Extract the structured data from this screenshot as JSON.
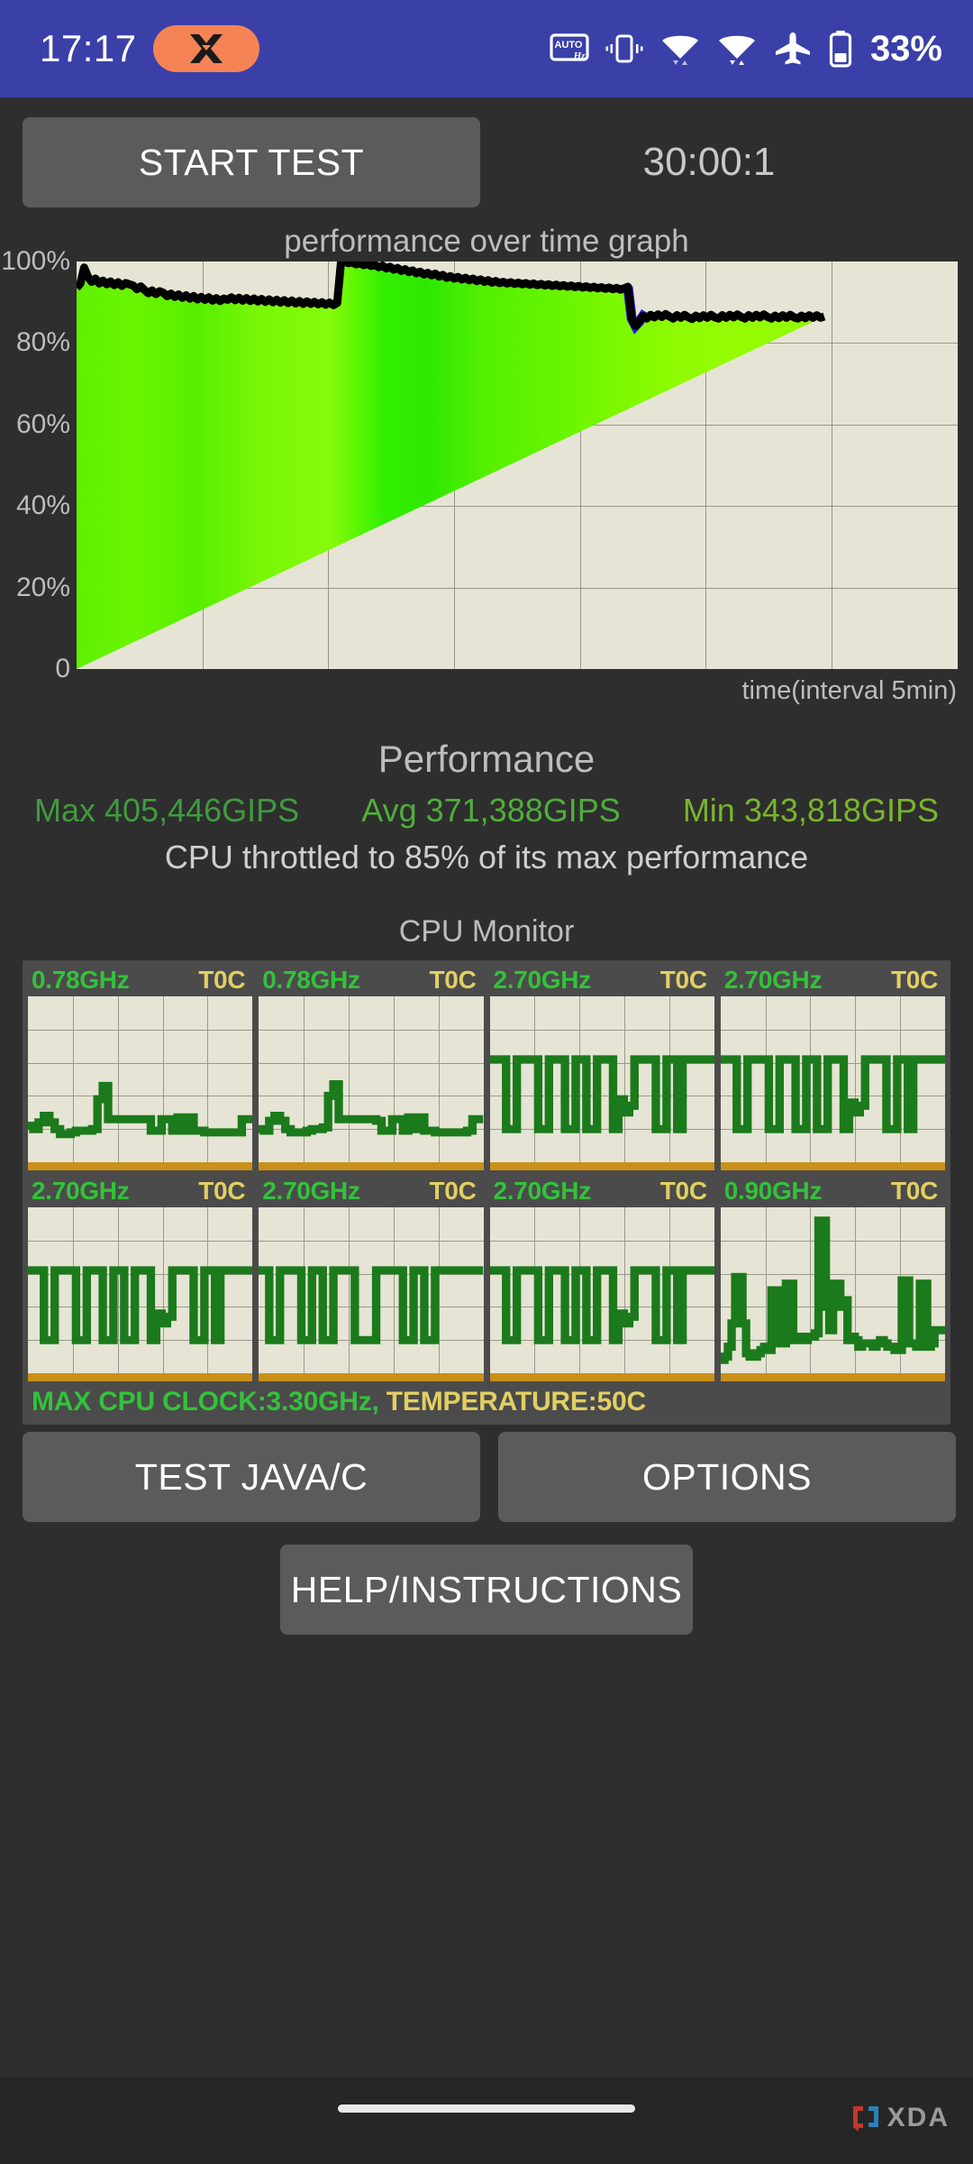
{
  "status_bar": {
    "clock": "17:17",
    "app_badge_icon": "x-logo-icon",
    "icons": [
      {
        "name": "auto-refresh-rate-icon",
        "label": "AUTO Hz"
      },
      {
        "name": "vibrate-icon",
        "label": "Vibrate"
      },
      {
        "name": "wifi-icon",
        "label": "Wi-Fi"
      },
      {
        "name": "wifi-data-icon",
        "label": "Wi-Fi data"
      },
      {
        "name": "airplane-mode-icon",
        "label": "Airplane mode"
      },
      {
        "name": "battery-icon",
        "label": "Battery"
      }
    ],
    "battery_percent": "33%",
    "bg_color": "#3a40a8",
    "accent_color": "#f58355"
  },
  "toolbar": {
    "start_test_label": "START TEST",
    "timer": "30:00:1"
  },
  "graph": {
    "title": "performance over time graph",
    "x_axis_label": "time(interval 5min)",
    "y_ticks": [
      "100%",
      "80%",
      "60%",
      "40%",
      "20%",
      "0"
    ],
    "bg_color": "#e6e4d4",
    "line_color": "#000000",
    "dip_color": "#2222dd"
  },
  "chart_data": {
    "type": "area",
    "title": "performance over time graph",
    "xlabel": "time(interval 5min)",
    "ylabel": "",
    "ylim": [
      0,
      100
    ],
    "yticks": [
      0,
      20,
      40,
      60,
      80,
      100
    ],
    "grid": true,
    "legend": "none",
    "x_interval_minutes": 5,
    "x_total_minutes": 35,
    "note": "Values are % of maximum performance; series ends at ~30 min of a 35 min axis",
    "series": [
      {
        "name": "performance %",
        "x": [
          0.0,
          0.15,
          0.3,
          0.45,
          0.6,
          0.75,
          0.9,
          1.05,
          1.2,
          1.35,
          1.5,
          1.65,
          1.8,
          1.95,
          2.1,
          2.25,
          2.4,
          2.55,
          2.7,
          2.85,
          3.0,
          3.15,
          3.3,
          3.45,
          3.6,
          3.75,
          3.9,
          4.05,
          4.2,
          4.35,
          4.5,
          4.65,
          4.8,
          4.95,
          5.1,
          5.25,
          5.4,
          5.55,
          5.7,
          5.85,
          6.0,
          6.15,
          6.3,
          6.45,
          6.6,
          6.75,
          6.9,
          7.05,
          7.2,
          7.35,
          7.5,
          7.65,
          7.8,
          7.95,
          8.1,
          8.25,
          8.4,
          8.55,
          8.7,
          8.85,
          9.0,
          9.15,
          9.3,
          9.45,
          9.6,
          9.75,
          9.9,
          10.05,
          10.2,
          10.35,
          10.5,
          10.65,
          10.8,
          10.95,
          11.1,
          11.25,
          11.4,
          11.55,
          11.7,
          11.85,
          12.0,
          12.15,
          12.3,
          12.45,
          12.6,
          12.75,
          12.9,
          13.05,
          13.2,
          13.35,
          13.5,
          13.65,
          13.8,
          13.95,
          14.1,
          14.25,
          14.4,
          14.55,
          14.7,
          14.85,
          15.0,
          15.15,
          15.3,
          15.45,
          15.6,
          15.75,
          15.9,
          16.05,
          16.2,
          16.35,
          16.5,
          16.65,
          16.8,
          16.95,
          17.1,
          17.25,
          17.4,
          17.55,
          17.7,
          17.85,
          18.0,
          18.15,
          18.3,
          18.45,
          18.6,
          18.75,
          18.9,
          19.05,
          19.2,
          19.35,
          19.5,
          19.65,
          19.8,
          19.95,
          20.1,
          20.25,
          20.4,
          20.55,
          20.7,
          20.85,
          21.0,
          21.15,
          21.3,
          21.45,
          21.6,
          21.75,
          21.9,
          22.05,
          22.2,
          22.35,
          22.5,
          22.65,
          22.8,
          22.95,
          23.1,
          23.25,
          23.4,
          23.55,
          23.7,
          23.85,
          24.0,
          24.15,
          24.3,
          24.45,
          24.6,
          24.75,
          24.9,
          25.05,
          25.2,
          25.35,
          25.5,
          25.65,
          25.8,
          25.95,
          26.1,
          26.25,
          26.4,
          26.55,
          26.7,
          26.85,
          27.0,
          27.15,
          27.3,
          27.45,
          27.6,
          27.75,
          27.9,
          28.05,
          28.2,
          28.35,
          28.5,
          28.65,
          28.8,
          28.95,
          29.1,
          29.25,
          29.4,
          29.55,
          29.7,
          29.85,
          30.0
        ],
        "y": [
          93.5,
          94.6,
          98.5,
          96.3,
          95.0,
          95.8,
          94.6,
          95.3,
          94.4,
          95.1,
          94.2,
          94.9,
          94.0,
          94.7,
          94.4,
          94.1,
          93.2,
          93.9,
          93.0,
          92.2,
          92.9,
          92.0,
          92.7,
          92.3,
          91.5,
          92.1,
          91.3,
          91.9,
          91.1,
          91.7,
          90.9,
          91.5,
          90.7,
          91.3,
          90.6,
          91.2,
          90.4,
          91.0,
          90.3,
          90.9,
          90.6,
          91.2,
          90.5,
          91.1,
          90.4,
          91.0,
          90.3,
          90.9,
          90.2,
          90.8,
          90.1,
          90.7,
          90.0,
          90.6,
          89.9,
          90.5,
          89.8,
          90.4,
          89.7,
          90.3,
          89.6,
          90.2,
          89.6,
          90.1,
          89.5,
          90.0,
          89.4,
          89.9,
          89.3,
          89.8,
          99.6,
          100.0,
          99.6,
          99.8,
          99.3,
          99.6,
          99.1,
          99.4,
          98.9,
          99.2,
          98.6,
          99.0,
          98.3,
          98.7,
          98.0,
          98.4,
          97.7,
          98.1,
          97.4,
          97.8,
          97.1,
          97.5,
          96.8,
          97.2,
          96.6,
          97.0,
          96.3,
          96.7,
          96.0,
          96.4,
          95.8,
          96.2,
          95.6,
          96.0,
          95.4,
          95.8,
          95.2,
          95.6,
          95.0,
          95.4,
          94.8,
          95.2,
          94.7,
          95.0,
          94.6,
          94.9,
          94.5,
          94.8,
          94.4,
          94.7,
          94.3,
          94.6,
          94.2,
          94.5,
          94.1,
          94.4,
          94.0,
          94.3,
          93.9,
          94.2,
          93.8,
          94.1,
          93.7,
          94.0,
          93.6,
          93.9,
          93.5,
          93.8,
          93.4,
          93.7,
          93.3,
          93.6,
          93.2,
          93.5,
          93.1,
          93.4,
          93.8,
          86.0,
          84.2,
          85.2,
          86.6,
          86.0,
          86.9,
          86.3,
          87.0,
          86.4,
          87.1,
          86.5,
          86.0,
          86.8,
          86.2,
          86.9,
          86.3,
          85.9,
          86.7,
          86.1,
          86.8,
          86.2,
          86.9,
          86.3,
          86.0,
          86.8,
          86.2,
          86.9,
          86.3,
          87.0,
          86.4,
          86.0,
          86.8,
          86.2,
          86.9,
          86.3,
          87.0,
          86.4,
          86.0,
          86.7,
          86.1,
          86.8,
          86.2,
          86.9,
          86.3,
          86.0,
          86.7,
          86.1,
          86.8,
          86.2,
          86.8,
          86.2,
          86.5
        ]
      }
    ]
  },
  "performance": {
    "title": "Performance",
    "max_label": "Max 405,446GIPS",
    "avg_label": "Avg 371,388GIPS",
    "min_label": "Min 343,818GIPS",
    "max_color": "#3f9b3f",
    "avg_color": "#4fae3a",
    "min_color": "#79b52c",
    "throttle_note": "CPU throttled to 85% of its max performance"
  },
  "cpu_monitor": {
    "title": "CPU Monitor",
    "cores": [
      {
        "freq": "0.78GHz",
        "temp": "T0C",
        "load": [
          22,
          20,
          24,
          28,
          24,
          20,
          17,
          17,
          18,
          19,
          19,
          19,
          20,
          38,
          46,
          26,
          26,
          26,
          26,
          26,
          26,
          26,
          26,
          19,
          19,
          26,
          26,
          19,
          27,
          19,
          27,
          19,
          19,
          18,
          18,
          18,
          18,
          18,
          18,
          18,
          26,
          26,
          26
        ]
      },
      {
        "freq": "0.78GHz",
        "temp": "T0C",
        "load": [
          20,
          19,
          25,
          28,
          25,
          20,
          18,
          18,
          18,
          19,
          20,
          20,
          21,
          40,
          47,
          26,
          26,
          26,
          26,
          26,
          26,
          26,
          25,
          19,
          19,
          26,
          26,
          19,
          27,
          20,
          27,
          19,
          19,
          18,
          18,
          18,
          18,
          18,
          18,
          19,
          26,
          26,
          26
        ]
      },
      {
        "freq": "2.70GHz",
        "temp": "T0C",
        "load": [
          62,
          62,
          62,
          20,
          20,
          62,
          62,
          62,
          62,
          20,
          20,
          62,
          62,
          62,
          20,
          20,
          62,
          62,
          20,
          20,
          62,
          62,
          62,
          20,
          38,
          30,
          34,
          62,
          62,
          62,
          62,
          20,
          20,
          62,
          62,
          20,
          62,
          62,
          62,
          62,
          62,
          62,
          62
        ]
      },
      {
        "freq": "2.70GHz",
        "temp": "T0C",
        "load": [
          62,
          62,
          62,
          20,
          20,
          62,
          62,
          62,
          62,
          20,
          20,
          62,
          62,
          62,
          20,
          20,
          62,
          62,
          20,
          20,
          62,
          62,
          62,
          20,
          36,
          30,
          34,
          62,
          62,
          62,
          62,
          20,
          20,
          62,
          62,
          20,
          62,
          62,
          62,
          62,
          62,
          62,
          62
        ]
      },
      {
        "freq": "2.70GHz",
        "temp": "T0C",
        "load": [
          62,
          62,
          62,
          20,
          20,
          62,
          62,
          62,
          62,
          20,
          20,
          62,
          62,
          62,
          20,
          20,
          62,
          62,
          20,
          20,
          62,
          62,
          62,
          20,
          36,
          30,
          34,
          62,
          62,
          62,
          62,
          20,
          20,
          62,
          62,
          20,
          62,
          62,
          62,
          62,
          62,
          62,
          62
        ]
      },
      {
        "freq": "2.70GHz",
        "temp": "T0C",
        "load": [
          62,
          62,
          20,
          20,
          62,
          62,
          62,
          62,
          20,
          20,
          62,
          62,
          20,
          20,
          62,
          62,
          62,
          62,
          20,
          20,
          20,
          20,
          62,
          62,
          62,
          62,
          62,
          20,
          20,
          62,
          62,
          20,
          20,
          62,
          62,
          62,
          62,
          62,
          62,
          62,
          62,
          62,
          62
        ]
      },
      {
        "freq": "2.70GHz",
        "temp": "T0C",
        "load": [
          62,
          62,
          62,
          20,
          20,
          62,
          62,
          62,
          62,
          20,
          20,
          62,
          62,
          62,
          20,
          20,
          62,
          62,
          20,
          20,
          62,
          62,
          62,
          20,
          36,
          30,
          34,
          62,
          62,
          62,
          62,
          20,
          20,
          62,
          62,
          20,
          62,
          62,
          62,
          62,
          62,
          62,
          62
        ]
      },
      {
        "freq": "0.90GHz",
        "temp": "T0C",
        "load": [
          8,
          10,
          16,
          30,
          58,
          58,
          30,
          12,
          10,
          10,
          12,
          14,
          16,
          14,
          50,
          50,
          18,
          18,
          54,
          54,
          20,
          22,
          20,
          20,
          22,
          22,
          24,
          92,
          92,
          40,
          26,
          54,
          54,
          40,
          44,
          20,
          22,
          20,
          16,
          18,
          18,
          18,
          16,
          18,
          20,
          18,
          16,
          16,
          14,
          14,
          56,
          56,
          18,
          18,
          16,
          54,
          54,
          16,
          18,
          26,
          26,
          26,
          26
        ]
      }
    ],
    "footer_clock": "MAX CPU CLOCK:3.30GHz,",
    "footer_temp": " TEMPERATURE:50C",
    "panel_bg": "#4b4b4b",
    "plot_bg": "#e6e4d4",
    "trace_color": "#1b7a1b",
    "temp_bar_color": "#c9901a"
  },
  "actions": {
    "test_java_c_label": "TEST JAVA/C",
    "options_label": "OPTIONS",
    "help_label": "HELP/INSTRUCTIONS"
  },
  "watermark": {
    "text": "XDA",
    "bracket_left_color": "#c0392b",
    "bracket_right_color": "#2980b9"
  }
}
